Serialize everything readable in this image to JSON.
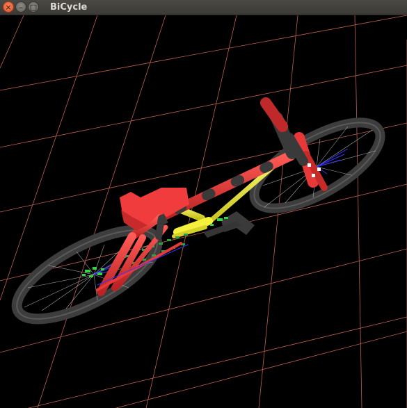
{
  "window": {
    "title": "BiCycle",
    "buttons": {
      "close_glyph": "×",
      "minimize_glyph": "–",
      "maximize_glyph": "□"
    }
  },
  "scene": {
    "background": "#000000",
    "grid_color": "#f08a73",
    "colors": {
      "frame_red": "#e8393a",
      "tire_dark": "#3d3d3d",
      "yellow_tubes": "#f4f03c",
      "seat_red": "#f03c3c",
      "chain_green": "#35d24a",
      "spokes_white": "#e6e6e6",
      "spokes_blue": "#3535ff"
    }
  }
}
